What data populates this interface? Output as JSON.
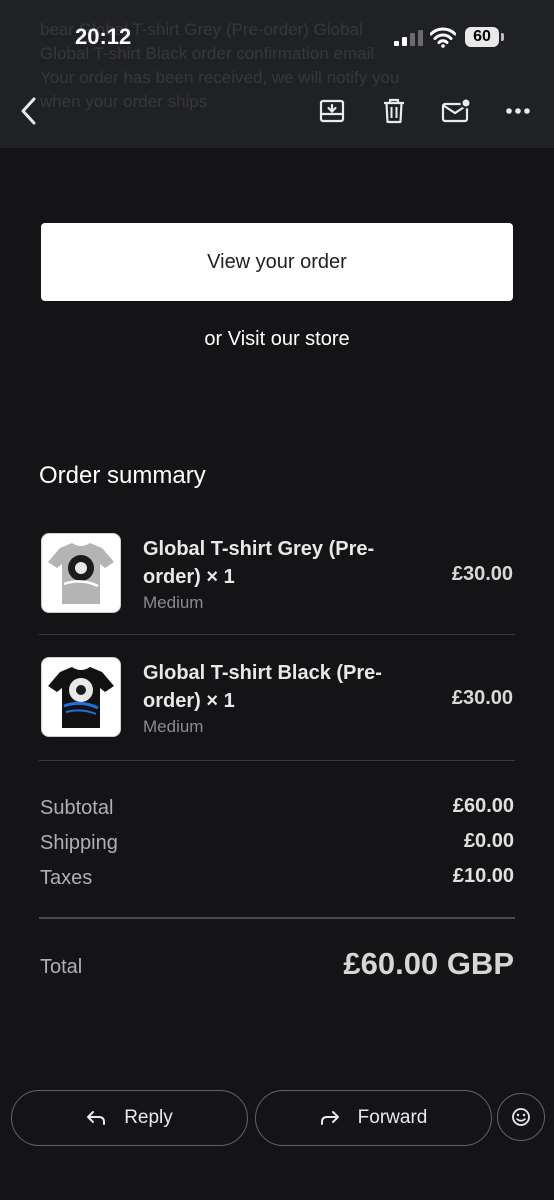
{
  "status_bar": {
    "time": "20:12",
    "battery": "60"
  },
  "background_text": [
    "bear Global T-shirt Grey (Pre-order) Global",
    "Global T-shirt Black order confirmation email",
    "Your order has been received, we will notify you",
    "when your order ships"
  ],
  "toolbar": {
    "back_icon": "back-arrow-icon",
    "archive_icon": "archive-icon",
    "delete_icon": "trash-icon",
    "unread_icon": "mark-unread-icon",
    "more_icon": "more-horizontal-icon"
  },
  "email": {
    "view_order_label": "View your order",
    "visit_store_prefix": "or ",
    "visit_store_link": "Visit our store",
    "summary_title": "Order summary",
    "items": [
      {
        "name": "Global T-shirt Grey (Pre-order) × 1",
        "variant": "Medium",
        "price": "£30.00",
        "shirt_color": "#b4b4b4"
      },
      {
        "name": "Global T-shirt Black (Pre-order) × 1",
        "variant": "Medium",
        "price": "£30.00",
        "shirt_color": "#111111"
      }
    ],
    "subtotal_label": "Subtotal",
    "subtotal_value": "£60.00",
    "shipping_label": "Shipping",
    "shipping_value": "£0.00",
    "taxes_label": "Taxes",
    "taxes_value": "£10.00",
    "total_label": "Total",
    "total_value": "£60.00 GBP"
  },
  "actions": {
    "reply_label": "Reply",
    "forward_label": "Forward",
    "emoji_icon": "emoji-reaction-icon"
  }
}
